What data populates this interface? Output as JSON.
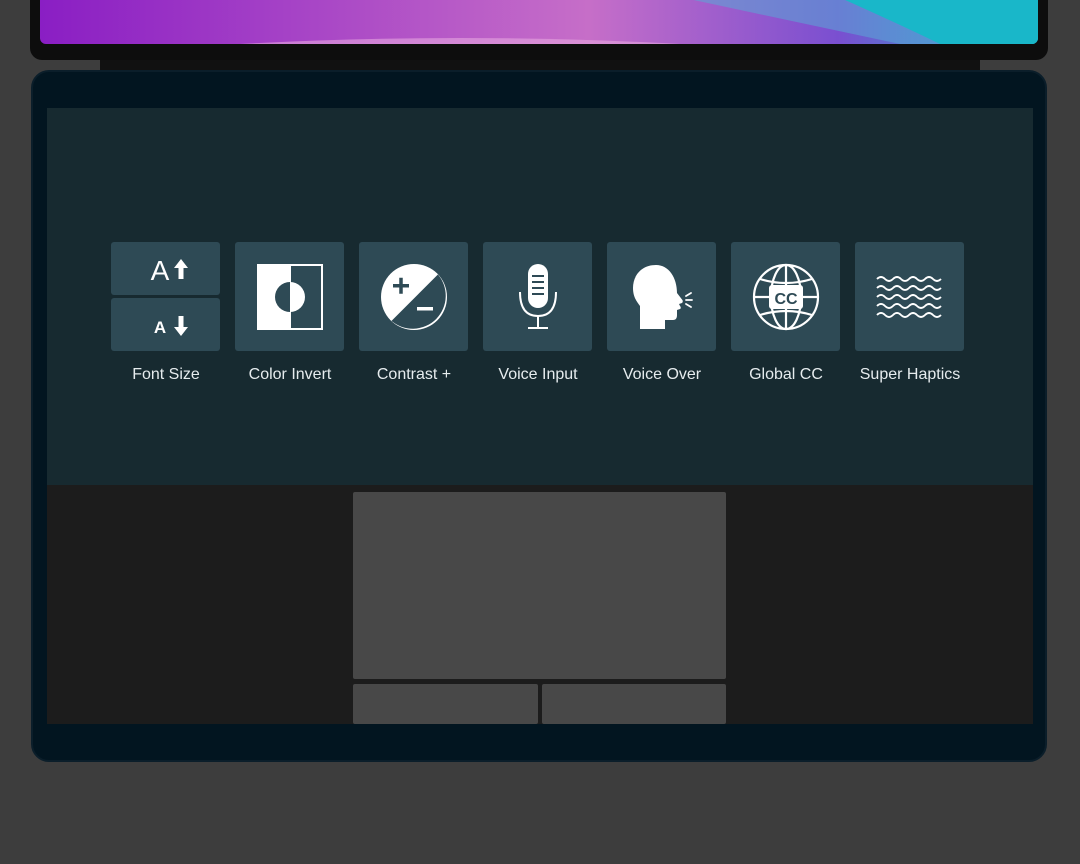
{
  "accessibility_bar": {
    "tools": [
      {
        "id": "font-size",
        "label": "Font Size",
        "icon": "font-size-icon"
      },
      {
        "id": "color-invert",
        "label": "Color Invert",
        "icon": "color-invert-icon"
      },
      {
        "id": "contrast",
        "label": "Contrast +",
        "icon": "contrast-icon"
      },
      {
        "id": "voice-input",
        "label": "Voice Input",
        "icon": "microphone-icon"
      },
      {
        "id": "voice-over",
        "label": "Voice Over",
        "icon": "speaking-head-icon"
      },
      {
        "id": "global-cc",
        "label": "Global CC",
        "icon": "globe-cc-icon"
      },
      {
        "id": "super-haptics",
        "label": "Super Haptics",
        "icon": "waves-icon"
      }
    ],
    "font_size": {
      "increase_glyph": "A",
      "decrease_glyph": "A"
    },
    "cc_text": "CC"
  },
  "colors": {
    "tile": "#2e4a55",
    "touchbar": "#172a30",
    "icon": "#ffffff",
    "label": "#e6ecee"
  }
}
